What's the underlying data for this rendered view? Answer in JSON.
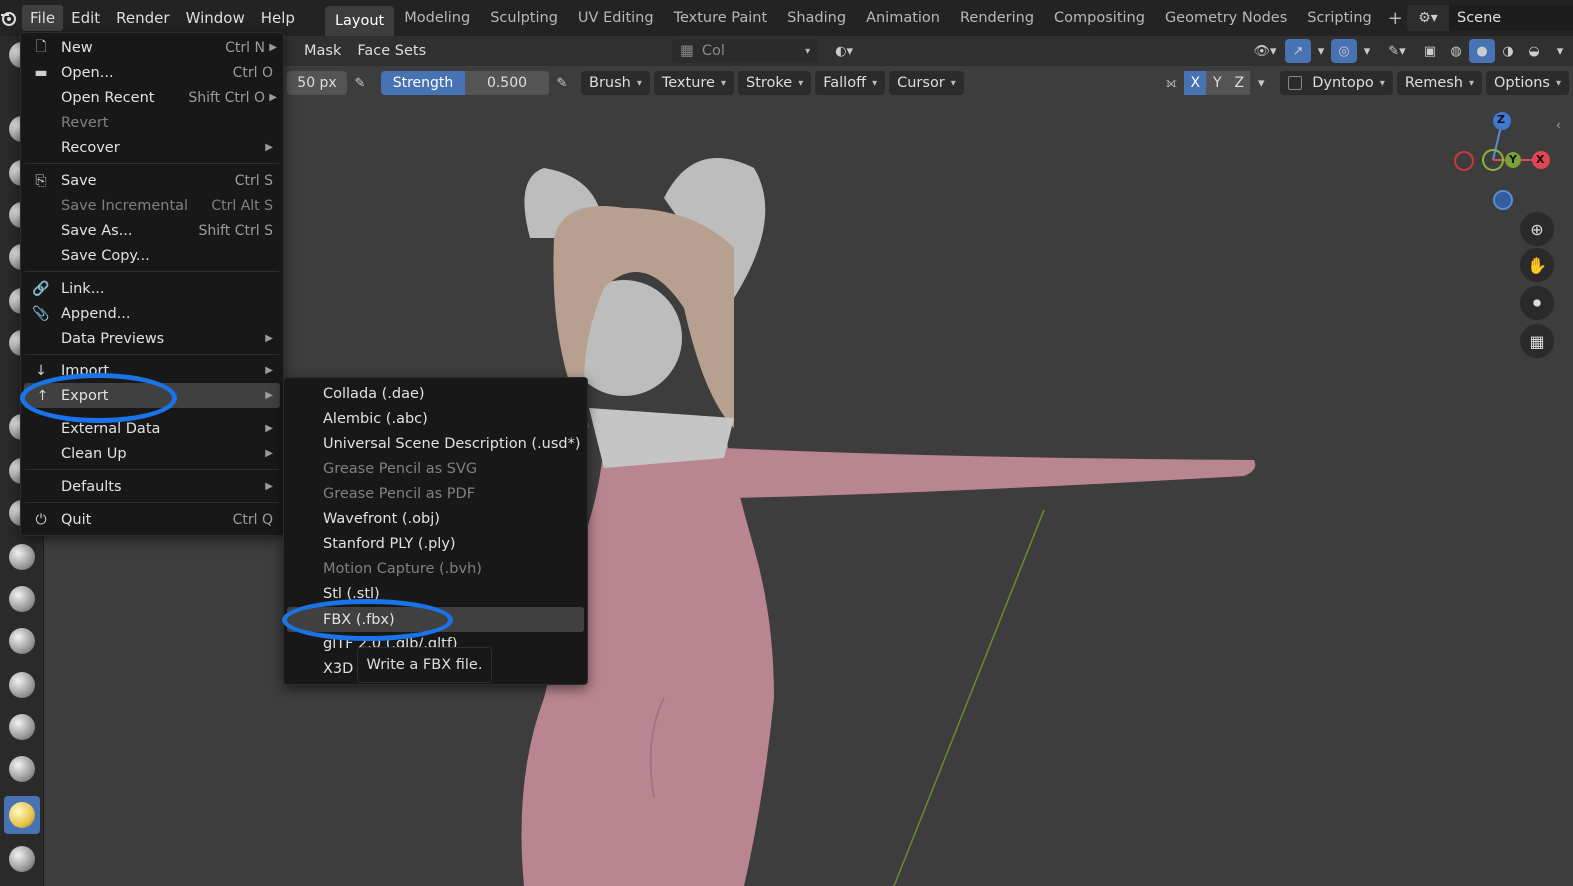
{
  "topbar": {
    "menus": [
      "File",
      "Edit",
      "Render",
      "Window",
      "Help"
    ],
    "workspaces": [
      "Layout",
      "Modeling",
      "Sculpting",
      "UV Editing",
      "Texture Paint",
      "Shading",
      "Animation",
      "Rendering",
      "Compositing",
      "Geometry Nodes",
      "Scripting"
    ],
    "active_workspace": "Layout",
    "scene": "Scene"
  },
  "header2": {
    "mask": "Mask",
    "face_sets": "Face Sets",
    "color_attr": "Col"
  },
  "header3": {
    "radius": "50 px",
    "strength_label": "Strength",
    "strength_value": "0.500",
    "dropdowns": [
      "Brush",
      "Texture",
      "Stroke",
      "Falloff",
      "Cursor"
    ],
    "axes": [
      "X",
      "Y",
      "Z"
    ],
    "dyntopo": "Dyntopo",
    "remesh": "Remesh",
    "options": "Options"
  },
  "file_menu": {
    "items": [
      {
        "label": "New",
        "shortcut": "Ctrl N",
        "icon": "new-file-icon",
        "submenu": true
      },
      {
        "label": "Open...",
        "shortcut": "Ctrl O",
        "icon": "folder-icon"
      },
      {
        "label": "Open Recent",
        "shortcut": "Shift Ctrl O",
        "submenu": true
      },
      {
        "label": "Revert",
        "disabled": true
      },
      {
        "label": "Recover",
        "submenu": true
      },
      {
        "label": "Save",
        "shortcut": "Ctrl S",
        "icon": "save-icon"
      },
      {
        "label": "Save Incremental",
        "shortcut": "Ctrl Alt S",
        "disabled": true
      },
      {
        "label": "Save As...",
        "shortcut": "Shift Ctrl S"
      },
      {
        "label": "Save Copy..."
      },
      {
        "label": "Link...",
        "icon": "link-icon"
      },
      {
        "label": "Append...",
        "icon": "append-icon"
      },
      {
        "label": "Data Previews",
        "submenu": true
      },
      {
        "label": "Import",
        "icon": "import-icon",
        "submenu": true
      },
      {
        "label": "Export",
        "icon": "export-icon",
        "submenu": true,
        "highlighted": true
      },
      {
        "label": "External Data",
        "submenu": true
      },
      {
        "label": "Clean Up",
        "submenu": true
      },
      {
        "label": "Defaults",
        "submenu": true
      },
      {
        "label": "Quit",
        "shortcut": "Ctrl Q",
        "icon": "quit-icon"
      }
    ]
  },
  "export_menu": {
    "items": [
      {
        "label": "Collada (.dae)"
      },
      {
        "label": "Alembic (.abc)"
      },
      {
        "label": "Universal Scene Description (.usd*)"
      },
      {
        "label": "Grease Pencil as SVG",
        "disabled": true
      },
      {
        "label": "Grease Pencil as PDF",
        "disabled": true
      },
      {
        "label": "Wavefront (.obj)"
      },
      {
        "label": "Stanford PLY (.ply)"
      },
      {
        "label": "Motion Capture (.bvh)",
        "disabled": true
      },
      {
        "label": "Stl (.stl)"
      },
      {
        "label": "FBX (.fbx)",
        "highlighted": true
      },
      {
        "label": "glTF 2.0 (.glb/.gltf)"
      },
      {
        "label": "X3D"
      }
    ]
  },
  "tooltip": "Write a FBX file.",
  "gizmo": {
    "z": "Z",
    "y": "Y",
    "x": "X"
  },
  "colors": {
    "accent": "#4772b3",
    "annotation": "#1a73e8",
    "skin": "#b98590",
    "hair": "#b8a091",
    "clay": "#bdbdbd"
  }
}
